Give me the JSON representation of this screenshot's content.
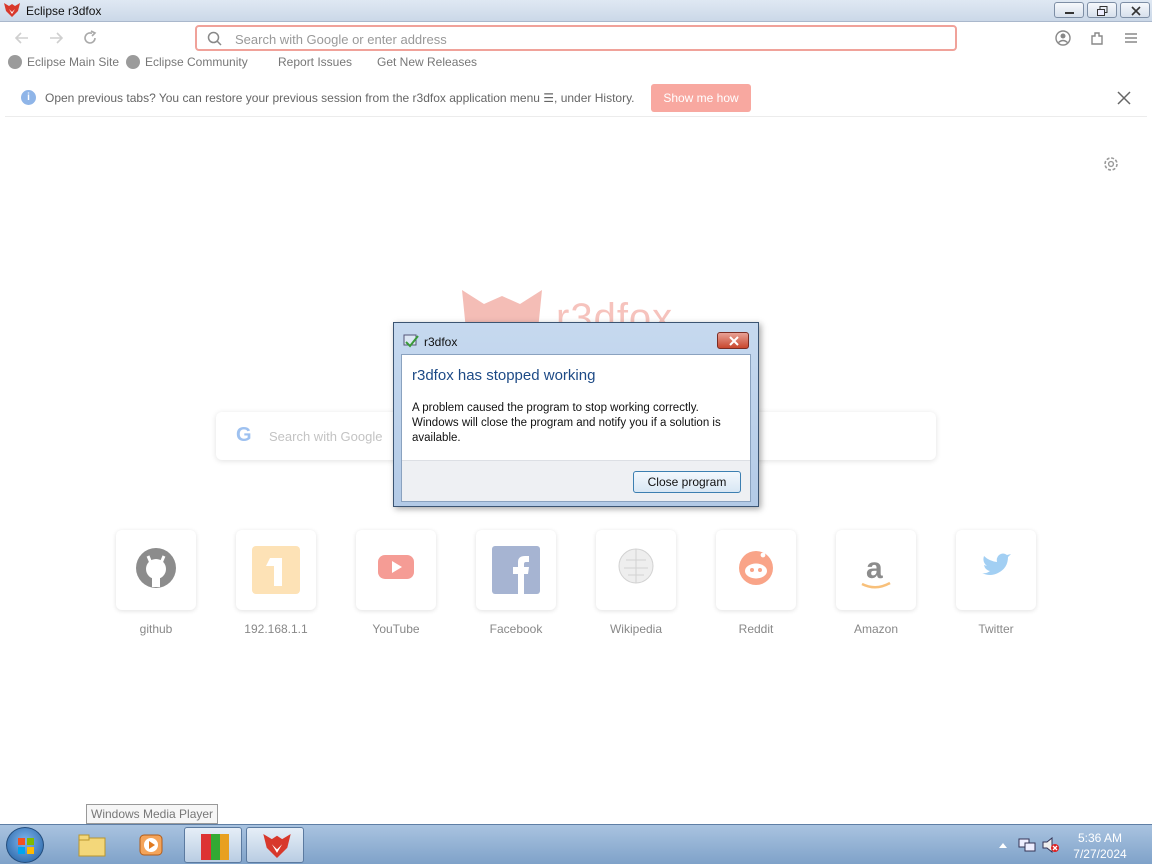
{
  "window": {
    "title": "Eclipse r3dfox"
  },
  "nav": {
    "url_placeholder": "Search with Google or enter address"
  },
  "bookmarks": [
    {
      "label": "Eclipse Main Site"
    },
    {
      "label": "Eclipse Community"
    },
    {
      "label": "Report Issues"
    },
    {
      "label": "Get New Releases"
    }
  ],
  "notice": {
    "message": "Open previous tabs? You can restore your previous session from the r3dfox application menu ☰, under History.",
    "button": "Show me how"
  },
  "newtab": {
    "logo_text": "r3dfox",
    "search_placeholder": "Search with Google",
    "tiles": [
      {
        "label": "github",
        "icon": "github-icon"
      },
      {
        "label": "192.168.1.1",
        "icon": "router-tile-icon"
      },
      {
        "label": "YouTube",
        "icon": "youtube-icon"
      },
      {
        "label": "Facebook",
        "icon": "facebook-icon"
      },
      {
        "label": "Wikipedia",
        "icon": "wikipedia-icon"
      },
      {
        "label": "Reddit",
        "icon": "reddit-icon"
      },
      {
        "label": "Amazon",
        "icon": "amazon-icon"
      },
      {
        "label": "Twitter",
        "icon": "twitter-icon"
      }
    ]
  },
  "dialog": {
    "title": "r3dfox",
    "heading": "r3dfox has stopped working",
    "body": "A problem caused the program to stop working correctly. Windows will close the program and notify you if a solution is available.",
    "button": "Close program"
  },
  "taskbar": {
    "tooltip": "Windows Media Player",
    "time": "5:36 AM",
    "date": "7/27/2024"
  },
  "colors": {
    "accent": "#f0a29a",
    "dialog_heading": "#1d4a86"
  }
}
